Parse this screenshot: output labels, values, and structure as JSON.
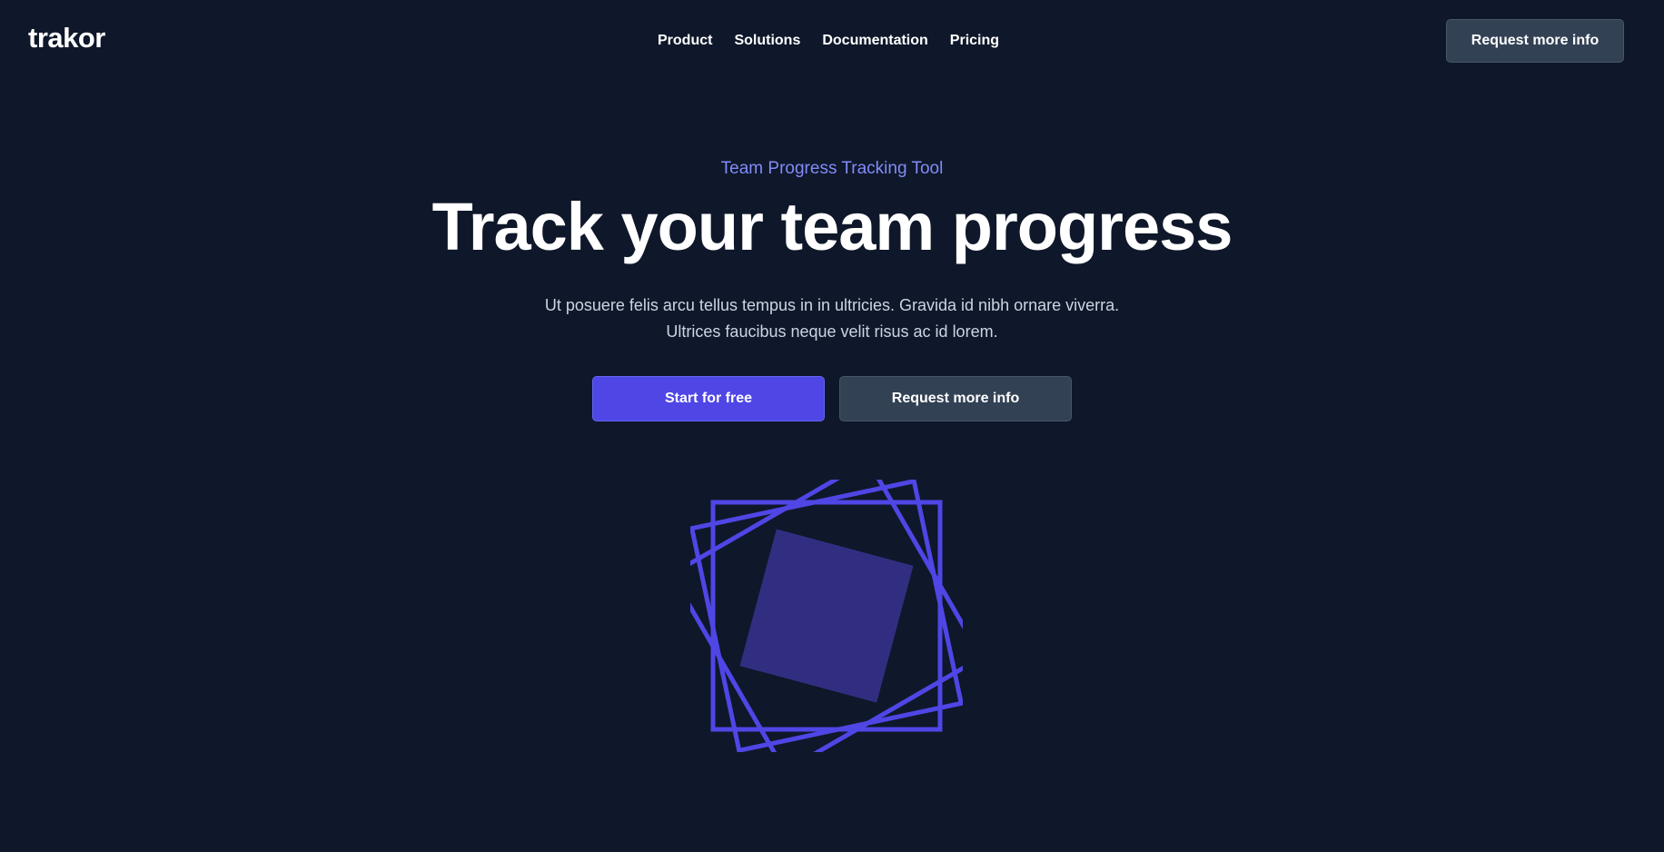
{
  "header": {
    "logo": "trakor",
    "nav": [
      "Product",
      "Solutions",
      "Documentation",
      "Pricing"
    ],
    "cta_label": "Request more info"
  },
  "hero": {
    "eyebrow": "Team Progress Tracking Tool",
    "headline": "Track your team progress",
    "subtext_line1": "Ut posuere felis arcu tellus tempus in in ultricies. Gravida id nibh ornare viverra.",
    "subtext_line2": "Ultrices faucibus neque velit risus ac id lorem.",
    "primary_cta": "Start for free",
    "secondary_cta": "Request more info"
  },
  "illustration": {
    "icon": "rotated-squares-graphic",
    "stroke_color": "#4f46e5",
    "fill_color": "#312e81"
  },
  "colors": {
    "background": "#0f172a",
    "accent": "#4f46e5",
    "eyebrow": "#818cf8",
    "secondary_button": "#334155"
  }
}
